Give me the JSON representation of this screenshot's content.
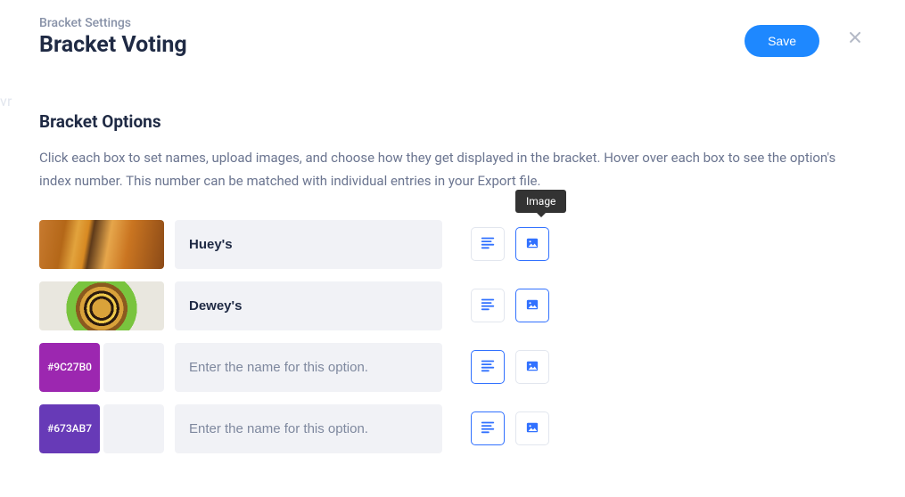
{
  "ghost": "vr",
  "header": {
    "breadcrumb": "Bracket Settings",
    "title": "Bracket Voting",
    "save_label": "Save"
  },
  "section": {
    "title": "Bracket Options",
    "description": "Click each box to set names, upload images, and choose how they get displayed in the bracket. Hover over each box to see the option's index number. This number can be matched with individual entries in your Export file."
  },
  "tooltip": {
    "image": "Image"
  },
  "placeholder": "Enter the name for this option.",
  "options": [
    {
      "name": "Huey's",
      "thumb_kind": "image",
      "image_class": "food1",
      "swatch": "",
      "swatch_hex": "",
      "mode": "image"
    },
    {
      "name": "Dewey's",
      "thumb_kind": "image",
      "image_class": "food2",
      "swatch": "",
      "swatch_hex": "",
      "mode": "image"
    },
    {
      "name": "",
      "thumb_kind": "swatch",
      "image_class": "",
      "swatch": "#9C27B0",
      "swatch_hex": "#9C27B0",
      "mode": "text"
    },
    {
      "name": "",
      "thumb_kind": "swatch",
      "image_class": "",
      "swatch": "#673AB7",
      "swatch_hex": "#673AB7",
      "mode": "text"
    }
  ]
}
